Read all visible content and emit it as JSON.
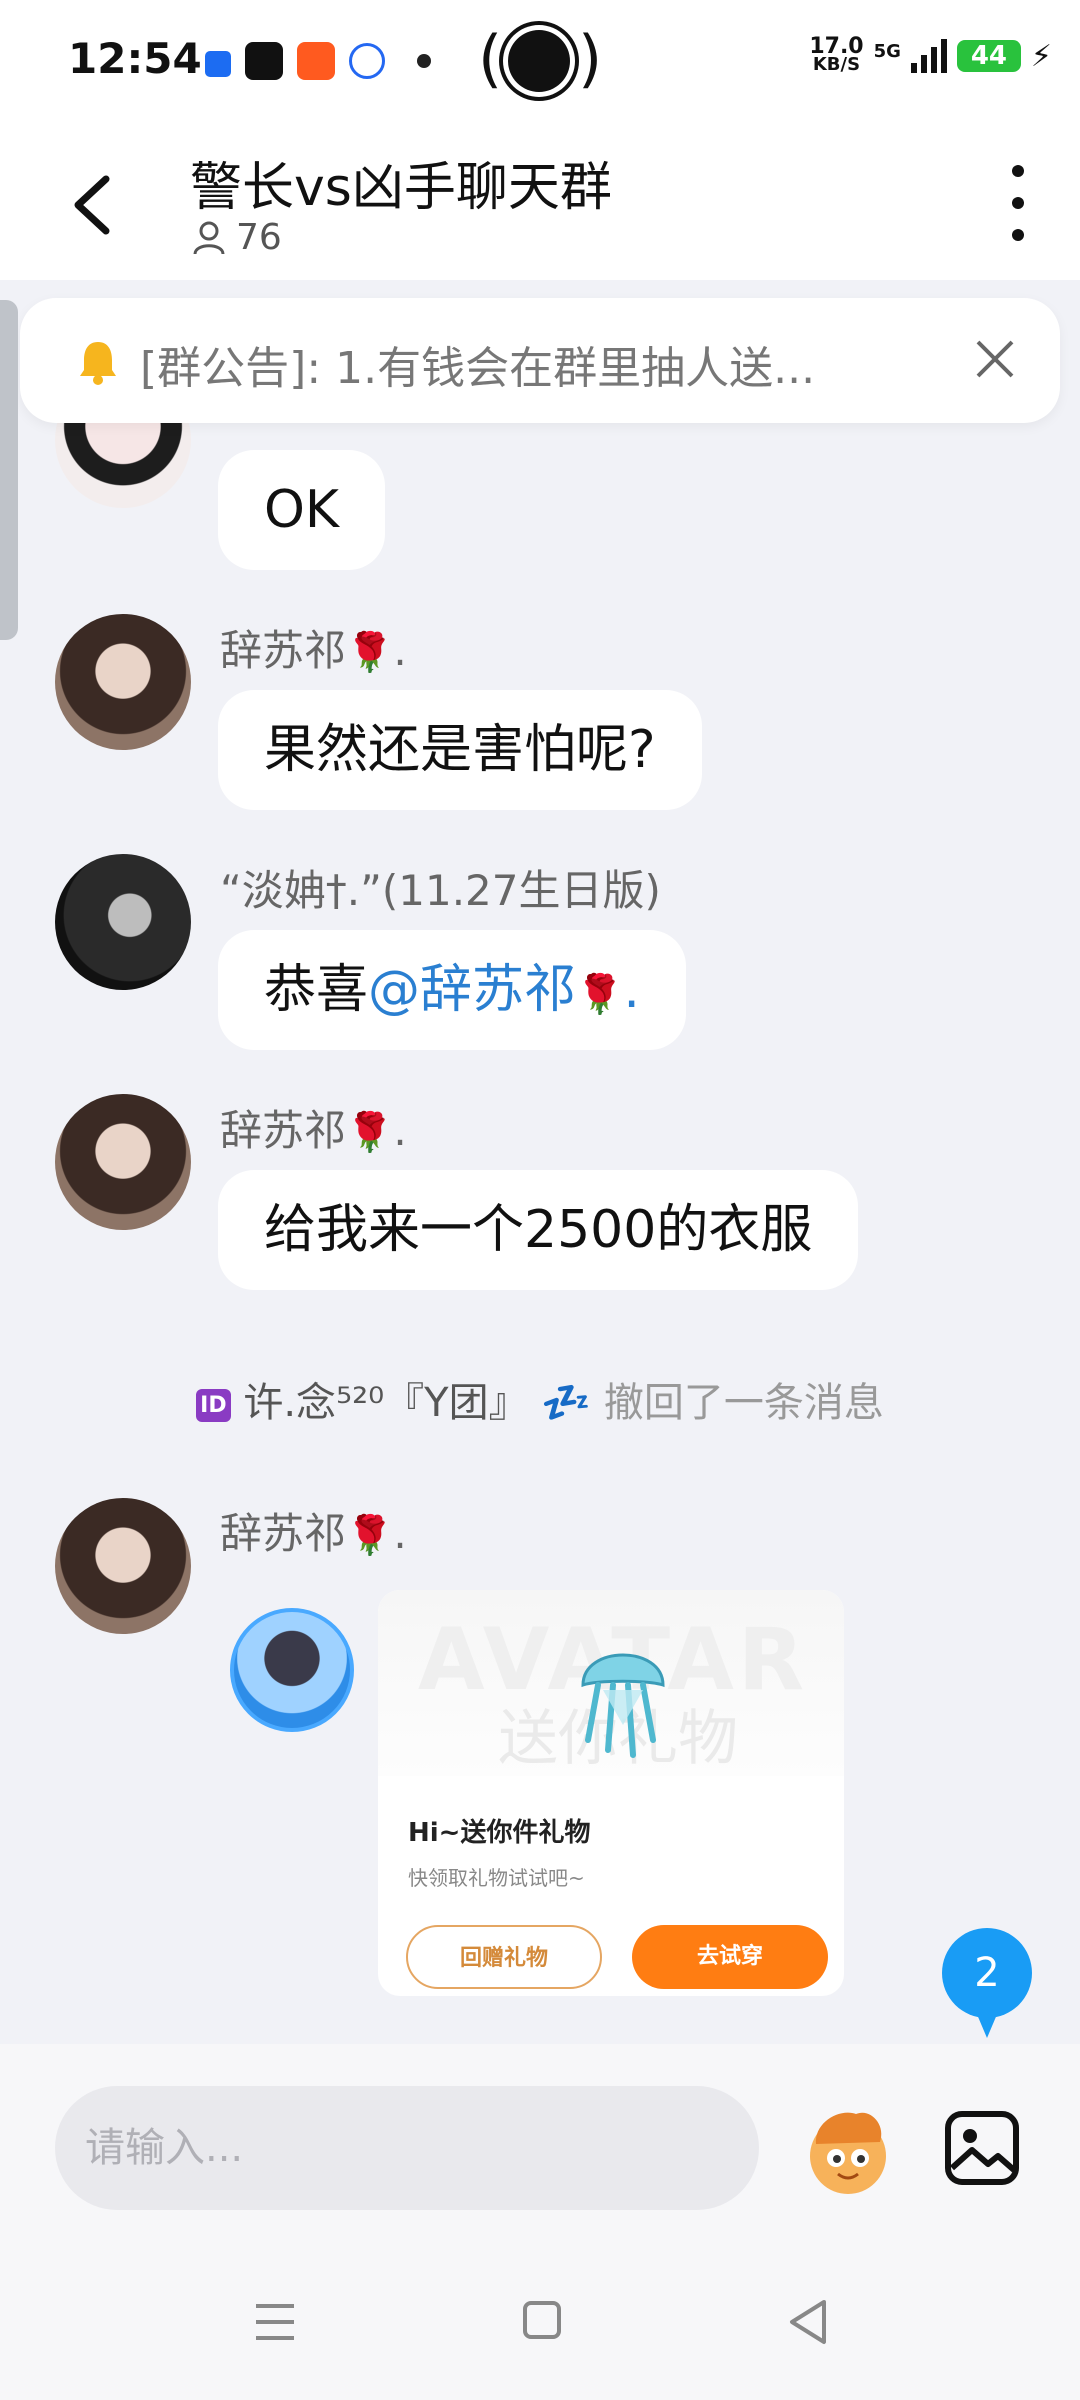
{
  "status_bar": {
    "time": "12:54",
    "net_speed_value": "17.0",
    "net_speed_unit": "KB/S",
    "network": "5G",
    "battery": "44"
  },
  "header": {
    "title": "警长vs凶手聊天群",
    "member_count": "76"
  },
  "notice": {
    "text": "[群公告]: 1.有钱会在群里抽人送..."
  },
  "messages": [
    {
      "text": "OK"
    },
    {
      "sender": "辞苏祁",
      "sender_suffix": ".",
      "text": "果然还是害怕呢?"
    },
    {
      "sender": "“淡姌†.”(11.27生日版)",
      "text_prefix": "恭喜",
      "mention": "@辞苏祁",
      "mention_suffix": "."
    },
    {
      "sender": "辞苏祁",
      "sender_suffix": ".",
      "text": "给我来一个2500的衣服"
    },
    {
      "sender": "辞苏祁",
      "sender_suffix": "."
    }
  ],
  "recall": {
    "badge": "ID",
    "name": "许.念⁵²⁰『Y团』",
    "zz": "💤",
    "action": "撤回了一条消息"
  },
  "gift_card": {
    "watermark": "AVATAR",
    "watermark2": "送你礼物",
    "title": "Hi~送你件礼物",
    "subtitle": "快领取礼物试试吧~",
    "button_return": "回赠礼物",
    "button_try": "去试穿"
  },
  "unread_count": "2",
  "input": {
    "placeholder": "请输入..."
  },
  "icons": {
    "rose": "🌹",
    "bell": "bell-icon"
  },
  "colors": {
    "accent_blue": "#199cf5",
    "mention": "#2a7fd1",
    "orange": "#ff7d12",
    "battery": "#29c23d"
  }
}
